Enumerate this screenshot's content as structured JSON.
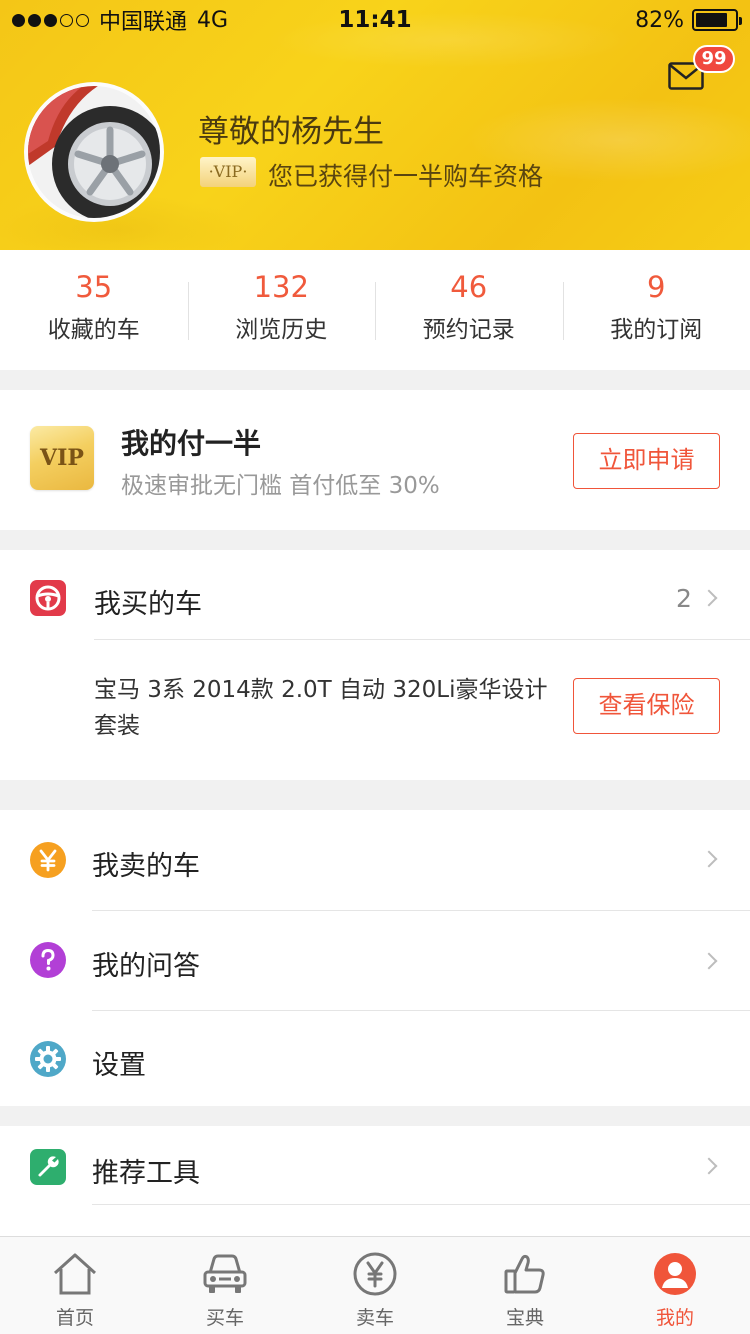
{
  "status_bar": {
    "carrier": "中国联通",
    "network": "4G",
    "time": "11:41",
    "battery": "82%",
    "battery_level": 0.82,
    "signal_strength": 3,
    "signal_max": 5
  },
  "header": {
    "mail_badge": "99",
    "user_name": "尊敬的杨先生",
    "vip_tag": "·VIP·",
    "vip_status": "您已获得付一半购车资格"
  },
  "stats": [
    {
      "value": "35",
      "label": "收藏的车"
    },
    {
      "value": "132",
      "label": "浏览历史"
    },
    {
      "value": "46",
      "label": "预约记录"
    },
    {
      "value": "9",
      "label": "我的订阅"
    }
  ],
  "vip_card": {
    "badge": "VIP",
    "title": "我的付一半",
    "subtitle": "极速审批无门槛 首付低至 30%",
    "button": "立即申请"
  },
  "bought": {
    "label": "我买的车",
    "count": "2",
    "car_description": "宝马 3系 2014款 2.0T 自动 320Li豪华设计套装",
    "button": "查看保险"
  },
  "menu": [
    {
      "label": "我卖的车",
      "icon": "yen-icon",
      "color": "#f6a020"
    },
    {
      "label": "我的问答",
      "icon": "question-icon",
      "color": "#b23fd6"
    },
    {
      "label": "设置",
      "icon": "gear-icon",
      "color": "#4fa8c8"
    },
    {
      "label": "推荐工具",
      "icon": "wrench-icon",
      "color": "#2eae6e"
    }
  ],
  "tabbar": [
    {
      "label": "首页",
      "icon": "home-icon"
    },
    {
      "label": "买车",
      "icon": "car-icon"
    },
    {
      "label": "卖车",
      "icon": "yen-circle-icon"
    },
    {
      "label": "宝典",
      "icon": "thumbs-up-icon"
    },
    {
      "label": "我的",
      "icon": "user-icon",
      "active": true
    }
  ],
  "colors": {
    "accent": "#f0553a",
    "header_yellow": "#f6cd16",
    "badge_red": "#f0483e"
  }
}
